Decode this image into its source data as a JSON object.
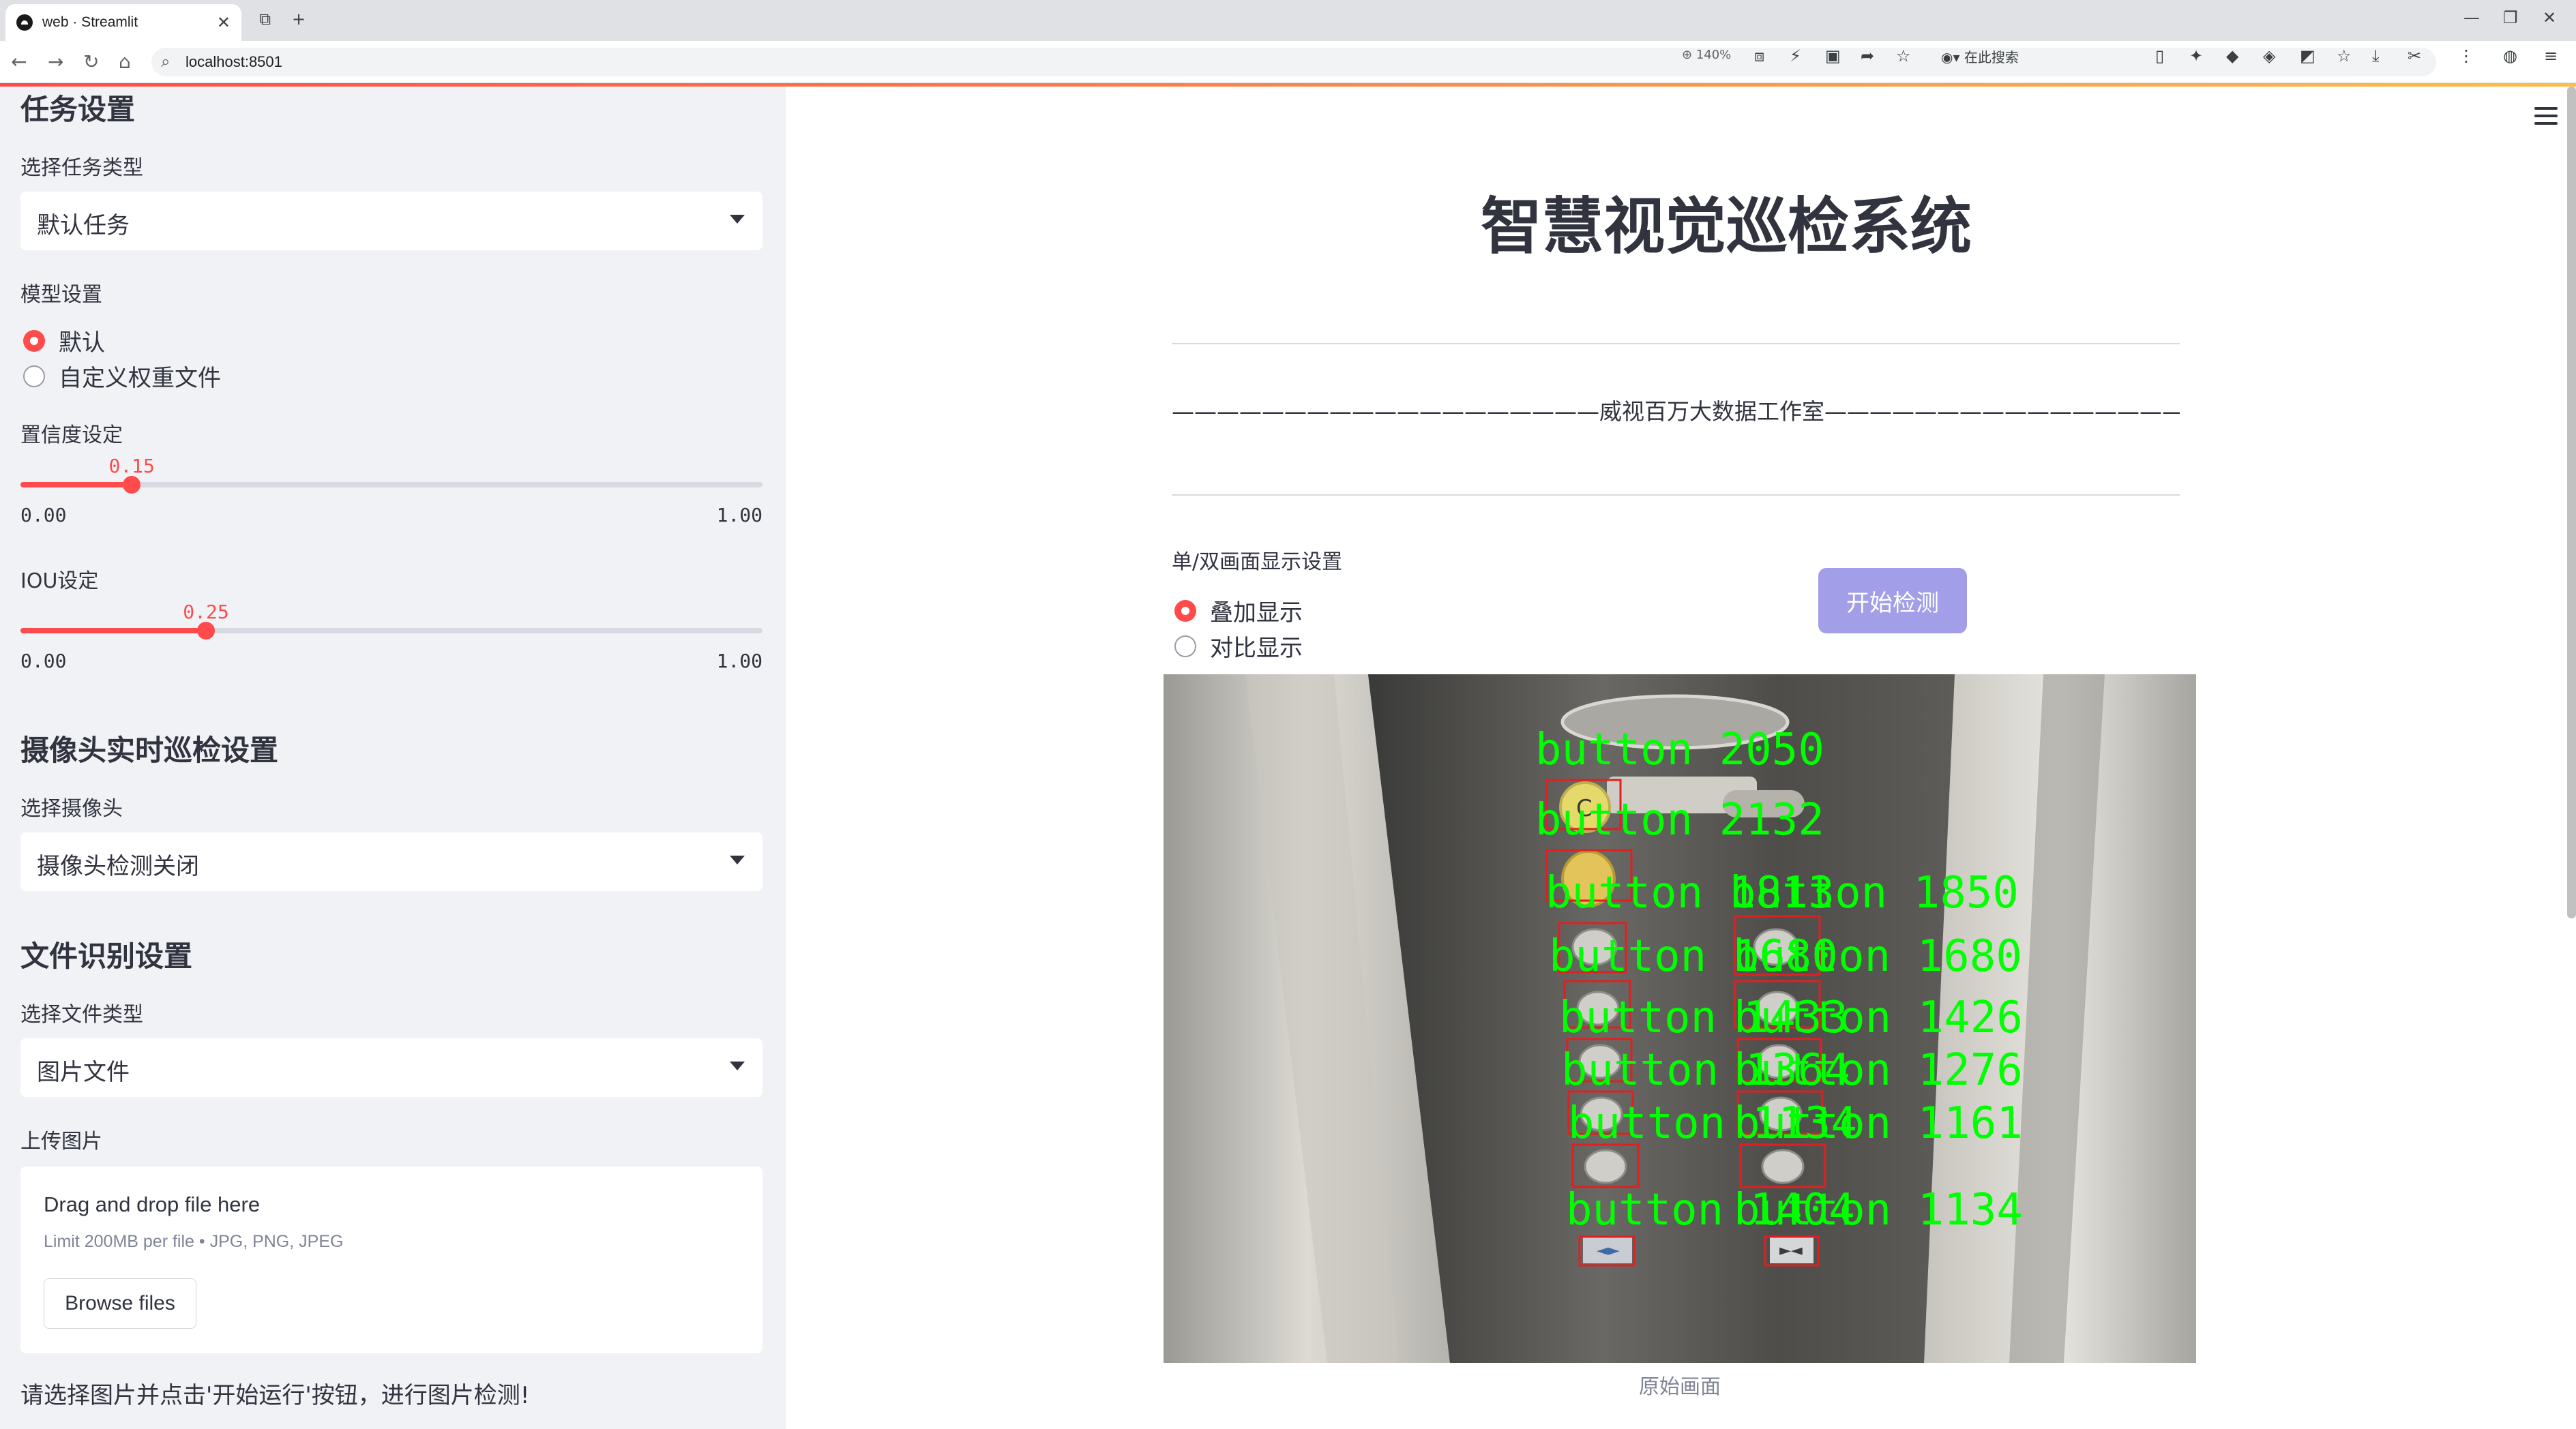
{
  "browser": {
    "tab_title": "web · Streamlit",
    "url": "localhost:8501",
    "zoom": "140%",
    "search_placeholder": "在此搜索"
  },
  "sidebar": {
    "task_section": "任务设置",
    "task_type_label": "选择任务类型",
    "task_type_value": "默认任务",
    "model_label": "模型设置",
    "model_options": [
      "默认",
      "自定义权重文件"
    ],
    "model_selected": 0,
    "conf_label": "置信度设定",
    "conf": {
      "value": "0.15",
      "fraction": 0.15,
      "min": "0.00",
      "max": "1.00"
    },
    "iou_label": "IOU设定",
    "iou": {
      "value": "0.25",
      "fraction": 0.25,
      "min": "0.00",
      "max": "1.00"
    },
    "camera_section": "摄像头实时巡检设置",
    "camera_label": "选择摄像头",
    "camera_value": "摄像头检测关闭",
    "file_section": "文件识别设置",
    "file_type_label": "选择文件类型",
    "file_type_value": "图片文件",
    "upload_label": "上传图片",
    "uploader": {
      "title": "Drag and drop file here",
      "limit": "Limit 200MB per file • JPG, PNG, JPEG",
      "button": "Browse files"
    },
    "hint": "请选择图片并点击'开始运行'按钮，进行图片检测!"
  },
  "main": {
    "title": "智慧视觉巡检系统",
    "studio": "———————————————————威视百万大数据工作室———————————————————",
    "display_label": "单/双画面显示设置",
    "display_options": [
      "叠加显示",
      "对比显示"
    ],
    "display_selected": 0,
    "start_button": "开始检测",
    "caption": "原始画面",
    "detections": [
      "button 2050",
      "button 2132",
      "button 1813",
      "button 1850",
      "button 1680",
      "button 1680",
      "button 1433",
      "button 1426",
      "button 1364",
      "button 1276",
      "button 1134",
      "button 1161",
      "button 1404",
      "button 1134"
    ]
  },
  "colors": {
    "accent": "#ff4b4b",
    "sidebar_bg": "#f0f2f6",
    "button_bg": "#a29ee8",
    "detection_text": "#00ff00",
    "detection_box": "#e02020"
  }
}
